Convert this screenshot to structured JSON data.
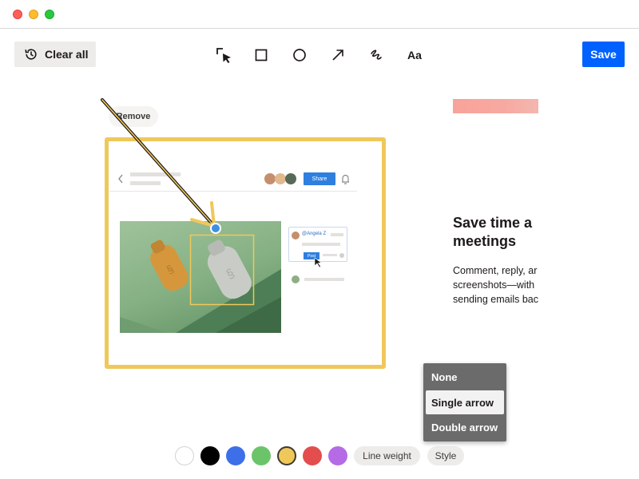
{
  "toolbar": {
    "clear_label": "Clear all",
    "text_tool_label": "Aa",
    "save_label": "Save"
  },
  "canvas": {
    "remove_label": "Remove",
    "mock_app": {
      "share_label": "Share",
      "comment_name": "@Angela Z",
      "post_label": "Post"
    }
  },
  "promo": {
    "title_line1": "Save time a",
    "title_line2": "meetings",
    "body_line1": "Comment, reply, ar",
    "body_line2": "screenshots—with",
    "body_line3": "sending emails bac"
  },
  "style_menu": {
    "options": [
      "None",
      "Single arrow",
      "Double arrow"
    ],
    "selected": "Single arrow"
  },
  "palette": {
    "colors": [
      "#ffffff",
      "#000000",
      "#3d6fe8",
      "#6cc46a",
      "#f0c85a",
      "#e34d4d",
      "#b56be6"
    ],
    "selected_color": "#f0c85a"
  },
  "bottom": {
    "line_weight_label": "Line weight",
    "style_label": "Style"
  },
  "accent": "#0061fe",
  "annotation_color": "#f0c85a"
}
